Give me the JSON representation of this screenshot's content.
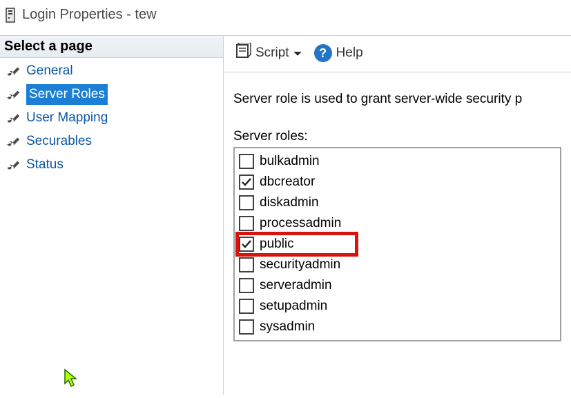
{
  "window": {
    "title": "Login Properties - tew"
  },
  "sidebar": {
    "header": "Select a page",
    "items": [
      {
        "label": "General",
        "selected": false
      },
      {
        "label": "Server Roles",
        "selected": true
      },
      {
        "label": "User Mapping",
        "selected": false
      },
      {
        "label": "Securables",
        "selected": false
      },
      {
        "label": "Status",
        "selected": false
      }
    ]
  },
  "toolbar": {
    "script_label": "Script",
    "help_label": "Help"
  },
  "content": {
    "description": "Server role is used to grant server-wide security p",
    "roles_label": "Server roles:",
    "roles": [
      {
        "name": "bulkadmin",
        "checked": false,
        "highlighted": false
      },
      {
        "name": "dbcreator",
        "checked": true,
        "highlighted": false
      },
      {
        "name": "diskadmin",
        "checked": false,
        "highlighted": false
      },
      {
        "name": "processadmin",
        "checked": false,
        "highlighted": false
      },
      {
        "name": "public",
        "checked": true,
        "highlighted": true
      },
      {
        "name": "securityadmin",
        "checked": false,
        "highlighted": false
      },
      {
        "name": "serveradmin",
        "checked": false,
        "highlighted": false
      },
      {
        "name": "setupadmin",
        "checked": false,
        "highlighted": false
      },
      {
        "name": "sysadmin",
        "checked": false,
        "highlighted": false
      }
    ]
  }
}
